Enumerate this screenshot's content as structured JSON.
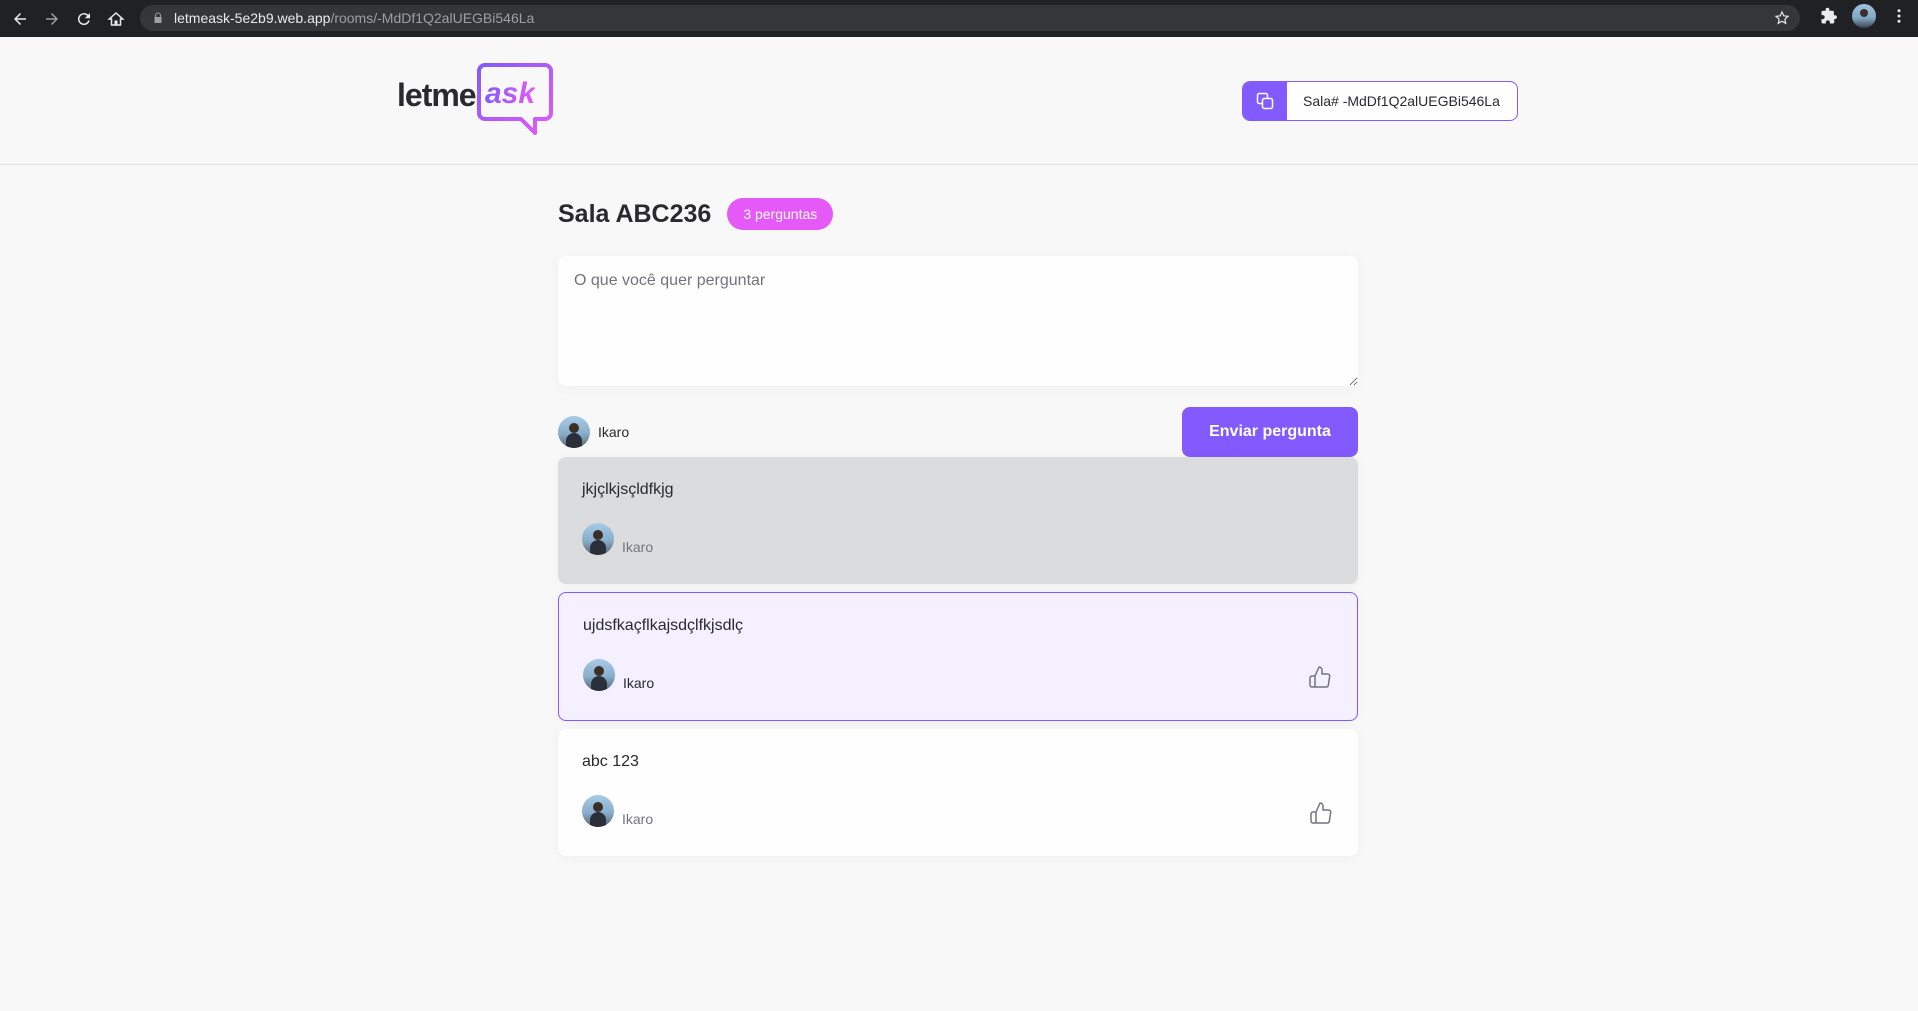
{
  "browser": {
    "url_host": "letmeask-5e2b9.web.app",
    "url_path": "/rooms/-MdDf1Q2alUEGBi546La"
  },
  "header": {
    "logo_text_1": "letme",
    "logo_text_2": "ask",
    "room_code_label": "Sala# -MdDf1Q2alUEGBi546La"
  },
  "room": {
    "title": "Sala ABC236",
    "questions_badge": "3 perguntas"
  },
  "form": {
    "placeholder": "O que você quer perguntar",
    "user_name": "Ikaro",
    "submit_label": "Enviar pergunta"
  },
  "questions": [
    {
      "content": "jkjçlkjsçldfkjg",
      "author": "Ikaro",
      "state": "answered"
    },
    {
      "content": "ujdsfkaçflkajsdçlfkjsdlç",
      "author": "Ikaro",
      "state": "highlighted"
    },
    {
      "content": "abc 123",
      "author": "Ikaro",
      "state": "default"
    }
  ],
  "colors": {
    "primary": "#835afd",
    "pink": "#e559f9",
    "answered_bg": "#dbdcdd",
    "highlighted_bg": "#f4f0ff"
  }
}
